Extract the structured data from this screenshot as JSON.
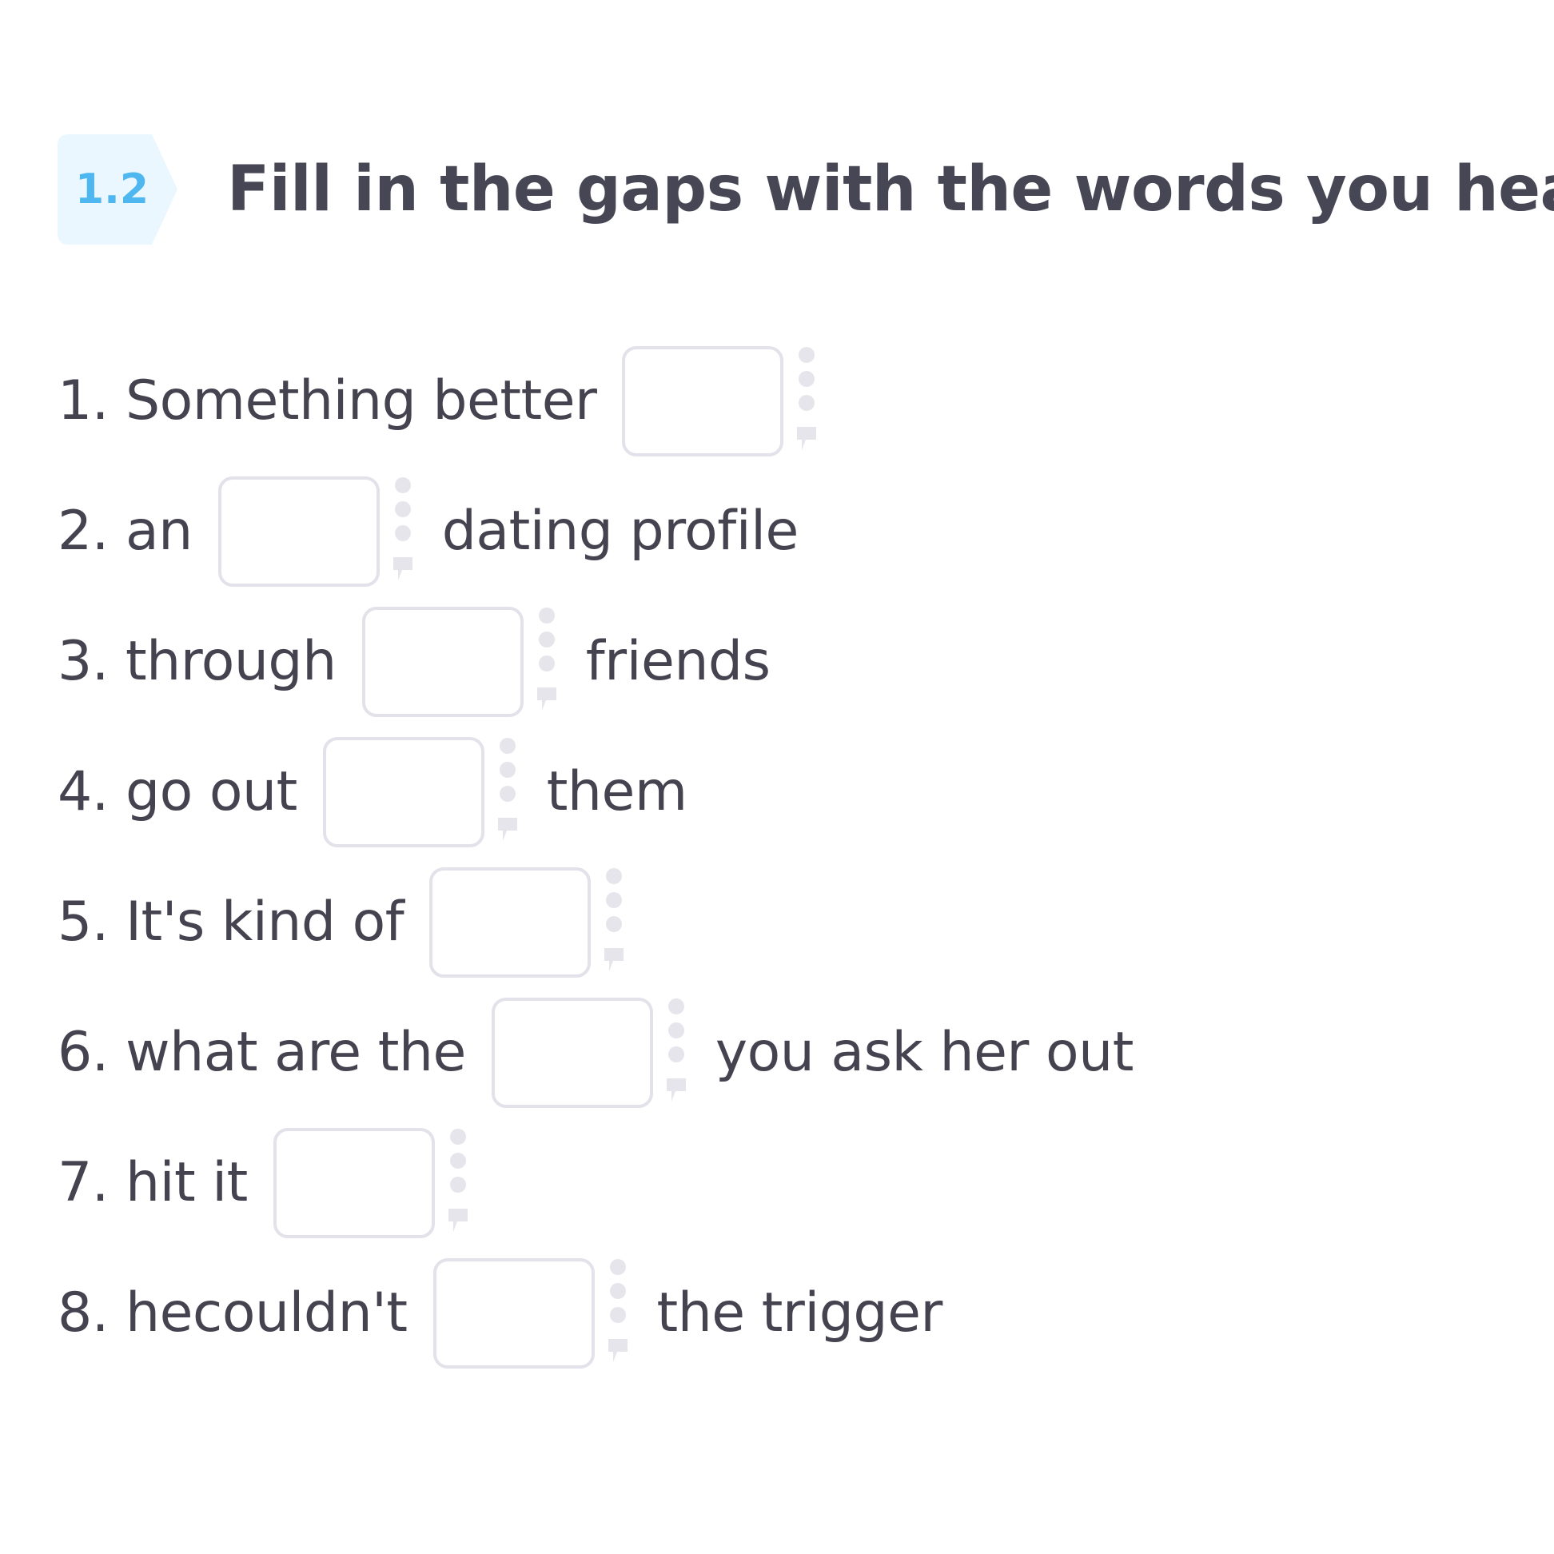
{
  "exercise": {
    "number": "1.2",
    "title": "Fill in the gaps with the words you hear"
  },
  "items": [
    {
      "before": "1. Something better",
      "gap_value": "",
      "after": ""
    },
    {
      "before": "2. an",
      "gap_value": "",
      "after": "dating profile"
    },
    {
      "before": "3. through",
      "gap_value": "",
      "after": "friends"
    },
    {
      "before": "4. go out",
      "gap_value": "",
      "after": "them"
    },
    {
      "before": "5. It's kind of",
      "gap_value": "",
      "after": ""
    },
    {
      "before": "6. what are the",
      "gap_value": "",
      "after": "you ask her out"
    },
    {
      "before": "7. hit it",
      "gap_value": "",
      "after": ""
    },
    {
      "before": "8.  hecouldn't",
      "gap_value": "",
      "after": "the trigger"
    }
  ],
  "colors": {
    "badge_bg": "#eaf7fe",
    "badge_text": "#4fb7ef",
    "text": "#44434f",
    "gap_border": "#e3e1ea",
    "handle": "#e6e5ec"
  },
  "icons": {
    "gap_handle": "dots-comment-icon"
  }
}
